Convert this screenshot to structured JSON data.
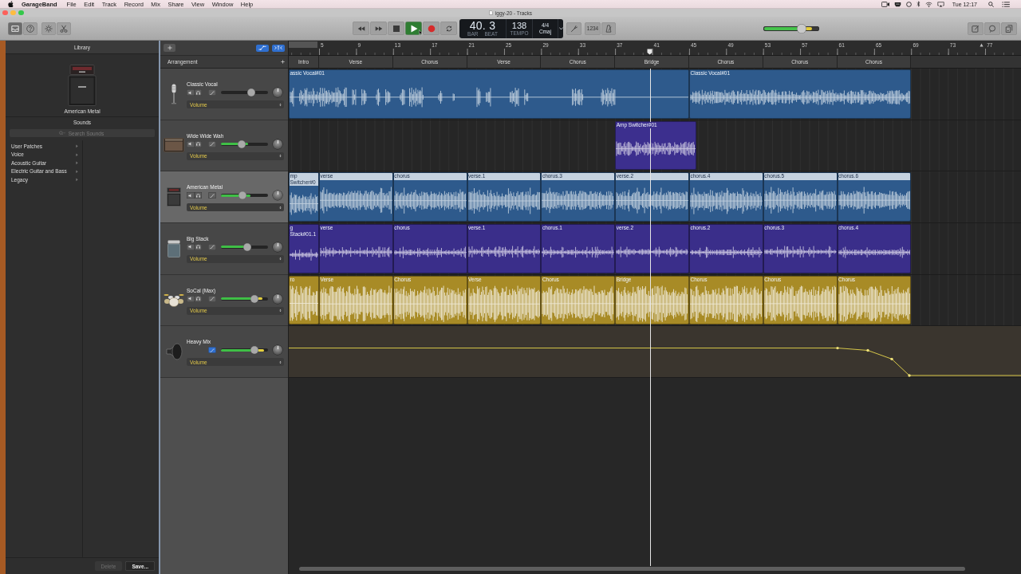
{
  "menu_bar": {
    "app": "GarageBand",
    "menus": [
      "File",
      "Edit",
      "Track",
      "Record",
      "Mix",
      "Share",
      "View",
      "Window",
      "Help"
    ],
    "clock": "Tue 12:17"
  },
  "window": {
    "title": "iggy-20 - Tracks"
  },
  "toolbar": {
    "view_buttons": [
      {
        "kind": "library",
        "on": true
      },
      {
        "kind": "help",
        "on": false
      },
      {
        "kind": "smart_controls",
        "on": false
      },
      {
        "kind": "editors",
        "on": false
      }
    ],
    "transport": [
      {
        "kind": "rewind",
        "on": false
      },
      {
        "kind": "forward",
        "on": false
      },
      {
        "kind": "stop",
        "on": false
      },
      {
        "kind": "play",
        "on": true
      },
      {
        "kind": "record",
        "on": false
      },
      {
        "kind": "cycle",
        "on": false
      }
    ],
    "lcd": {
      "position": "40. 3",
      "position_units": [
        "BAR",
        "BEAT"
      ],
      "tempo": "138",
      "tempo_unit": "TEMPO",
      "time_signature": "4/4",
      "key": "Cmaj"
    },
    "tuner": {
      "on": false
    },
    "count_in": {
      "label": "1234",
      "on": false
    },
    "metronome": {
      "on": false
    },
    "master_volume": {
      "level": 0.69
    },
    "output_meter": {
      "level": 0.86
    },
    "panel_buttons": [
      {
        "kind": "notes",
        "on": false
      },
      {
        "kind": "loops",
        "on": false
      },
      {
        "kind": "browser",
        "on": false
      }
    ]
  },
  "library": {
    "title": "Library",
    "patch": "American Metal",
    "sounds_title": "Sounds",
    "search": {
      "placeholder": "Search Sounds"
    },
    "categories": [
      {
        "label": "User Patches",
        "selected": false
      },
      {
        "label": "Voice",
        "selected": false
      },
      {
        "label": "Acoustic Guitar",
        "selected": false
      },
      {
        "label": "Electric Guitar and Bass",
        "selected": false
      },
      {
        "label": "Legacy",
        "selected": false
      }
    ],
    "buttons": [
      {
        "kind": "delete",
        "label": "Delete",
        "disabled": true
      },
      {
        "kind": "save",
        "label": "Save...",
        "disabled": false
      }
    ]
  },
  "track_list": {
    "buttons": [
      {
        "kind": "automation",
        "on": true
      },
      {
        "kind": "catch",
        "on": true
      }
    ],
    "arrangement_label": "Arrangement"
  },
  "ruler": {
    "bars": [
      "5",
      "9",
      "13",
      "17",
      "21",
      "25",
      "29",
      "33",
      "37",
      "41",
      "45",
      "49",
      "53",
      "57",
      "61",
      "65",
      "69",
      "73",
      "77"
    ]
  },
  "arrangement": [
    "Intro",
    "Verse",
    "Chorus",
    "Verse",
    "Chorus",
    "Bridge",
    "Chorus",
    "Chorus",
    "Chorus"
  ],
  "tracks": [
    {
      "name": "Classic Vocal",
      "kind": "vocal",
      "selected": false,
      "muted": false,
      "solo": false,
      "automation": false,
      "volume": {
        "level": 0.64
      },
      "pan": {
        "level": 0.5
      },
      "parameter": "Volume",
      "color": "#2e5a8c",
      "regions": [
        {
          "name": "assic Vocal#01",
          "selected": false
        },
        {
          "name": "Classic Vocal#01",
          "selected": false
        }
      ]
    },
    {
      "name": "Wide Wide Wah",
      "kind": "combo_amp",
      "selected": false,
      "muted": false,
      "solo": false,
      "automation": false,
      "volume": {
        "level": 0.44
      },
      "meter": {
        "level": 0.58
      },
      "pan": {
        "level": 0.5
      },
      "parameter": "Volume",
      "color": "#3c2f8e",
      "regions": [
        {
          "name": "Amp Switcher#01",
          "selected": false
        }
      ]
    },
    {
      "name": "American Metal",
      "kind": "stack_amp",
      "selected": true,
      "muted": false,
      "solo": false,
      "automation": false,
      "volume": {
        "level": 0.46
      },
      "meter": {
        "level": 0.63
      },
      "pan": {
        "level": 0.5
      },
      "parameter": "Volume",
      "color": "#2e5a8c",
      "regions": [
        {
          "name": "mp Switcher#0",
          "selected": true
        },
        {
          "name": "verse",
          "selected": true
        },
        {
          "name": "chorus",
          "selected": true
        },
        {
          "name": "verse.1",
          "selected": true
        },
        {
          "name": "chorus.3",
          "selected": true
        },
        {
          "name": "verse.2",
          "selected": true
        },
        {
          "name": "chorus.4",
          "selected": true
        },
        {
          "name": "chorus.5",
          "selected": true
        },
        {
          "name": "chorus.6",
          "selected": true
        }
      ]
    },
    {
      "name": "Big Stack",
      "kind": "cabinet_amp",
      "selected": false,
      "muted": false,
      "solo": false,
      "automation": false,
      "volume": {
        "level": 0.56
      },
      "meter": {
        "level": 0.57
      },
      "pan": {
        "level": 0.5
      },
      "parameter": "Volume",
      "color": "#3a2e8a",
      "regions": [
        {
          "name": "g Stack#01.1",
          "selected": false
        },
        {
          "name": "verse",
          "selected": false
        },
        {
          "name": "chorus",
          "selected": false
        },
        {
          "name": "verse.1",
          "selected": false
        },
        {
          "name": "chorus.1",
          "selected": false
        },
        {
          "name": "verse.2",
          "selected": false
        },
        {
          "name": "chorus.2",
          "selected": false
        },
        {
          "name": "chorus.3",
          "selected": false
        },
        {
          "name": "chorus.4",
          "selected": false
        }
      ]
    },
    {
      "name": "SoCal (Max)",
      "kind": "drummer",
      "selected": false,
      "muted": false,
      "solo": false,
      "automation": false,
      "volume": {
        "level": 0.71
      },
      "meter": {
        "level": 0.88
      },
      "pan": {
        "level": 0.5
      },
      "parameter": "Volume",
      "color": "#a88b26",
      "regions": [
        {
          "name": "ro",
          "selected": false
        },
        {
          "name": "Verse",
          "selected": false
        },
        {
          "name": "Chorus",
          "selected": false
        },
        {
          "name": "Verse",
          "selected": false
        },
        {
          "name": "Chorus",
          "selected": false
        },
        {
          "name": "Bridge",
          "selected": false
        },
        {
          "name": "Chorus",
          "selected": false
        },
        {
          "name": "Chorus",
          "selected": false
        },
        {
          "name": "Chorus",
          "selected": false
        }
      ]
    },
    {
      "name": "Heavy Mix",
      "kind": "master",
      "selected": false,
      "automation": true,
      "volume": {
        "level": 0.71
      },
      "meter": {
        "level": 0.92
      },
      "pan": {
        "level": 0.5
      },
      "parameter": "Volume"
    }
  ]
}
